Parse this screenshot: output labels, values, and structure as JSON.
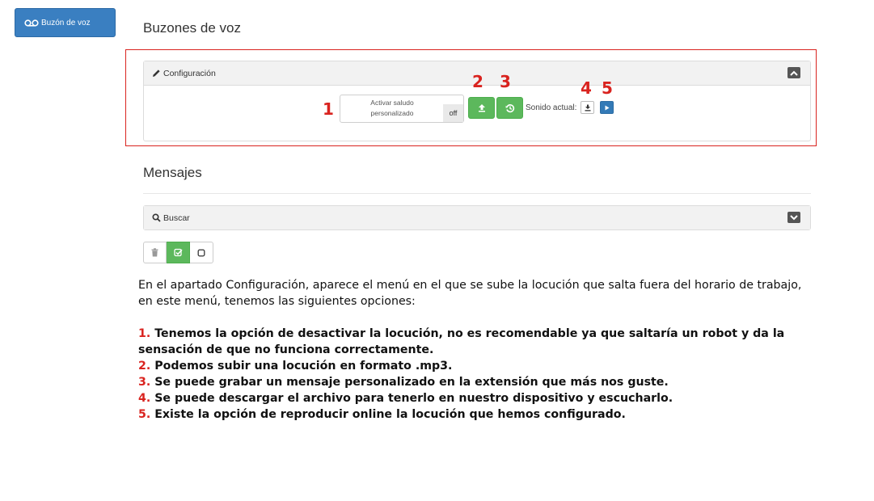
{
  "sidebar": {
    "voicemail_label": "Buzón de voz"
  },
  "header": {
    "title": "Buzones de voz"
  },
  "config": {
    "title": "Configuración",
    "toggle_label_line1": "Activar saludo",
    "toggle_label_line2": "personalizado",
    "toggle_state": "off",
    "current_sound_label": "Sonido actual:"
  },
  "callouts": [
    "1",
    "2",
    "3",
    "4",
    "5"
  ],
  "messages": {
    "title": "Mensajes",
    "search_label": "Buscar"
  },
  "explanation": {
    "intro": "En el apartado Configuración, aparece el menú en el que se sube la locución que salta fuera del horario de trabajo, en este menú, tenemos las siguientes opciones:",
    "items": [
      {
        "num": "1.",
        "text": "Tenemos la opción de desactivar la locución, no es recomendable ya que saltaría un robot y da la sensación de que no funciona correctamente."
      },
      {
        "num": "2.",
        "text": "Podemos subir una locución en formato .mp3."
      },
      {
        "num": "3.",
        "text": "Se puede grabar un mensaje personalizado en la extensión que más nos guste."
      },
      {
        "num": "4.",
        "text": "Se puede descargar el archivo para tenerlo en nuestro dispositivo y escucharlo."
      },
      {
        "num": "5.",
        "text": "Existe la opción de reproducir online la locución que hemos configurado."
      }
    ]
  },
  "colors": {
    "primary": "#3a7fc1",
    "success": "#5cb85c",
    "callout": "#d9231f"
  }
}
